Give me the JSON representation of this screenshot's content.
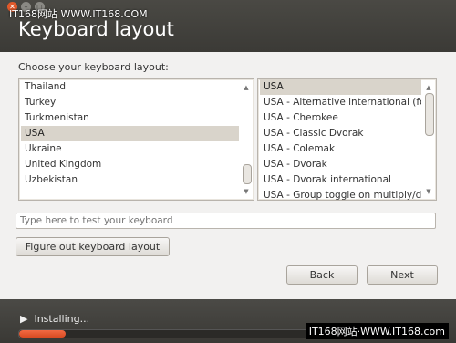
{
  "watermark_top": "IT168网站 WWW.IT168.COM",
  "watermark_bottom": "IT168网站·WWW.IT168.com",
  "window": {
    "title": "Keyboard layout"
  },
  "prompt": "Choose your keyboard layout:",
  "layouts": {
    "items": [
      "Thailand",
      "Turkey",
      "Turkmenistan",
      "USA",
      "Ukraine",
      "United Kingdom",
      "Uzbekistan"
    ],
    "selected": "USA"
  },
  "variants": {
    "items": [
      "USA",
      "USA - Alternative international (former",
      "USA - Cherokee",
      "USA - Classic Dvorak",
      "USA - Colemak",
      "USA - Dvorak",
      "USA - Dvorak international",
      "USA - Group toggle on multiply/divide"
    ],
    "selected": "USA"
  },
  "test_input": {
    "placeholder": "Type here to test your keyboard",
    "value": ""
  },
  "buttons": {
    "figure_out": "Figure out keyboard layout",
    "back": "Back",
    "next": "Next"
  },
  "status": {
    "text": "Installing...",
    "progress": 0.15
  },
  "colors": {
    "accent": "#e0582a",
    "titlebar": "#3b3a36",
    "selection": "#d9d4cb"
  }
}
